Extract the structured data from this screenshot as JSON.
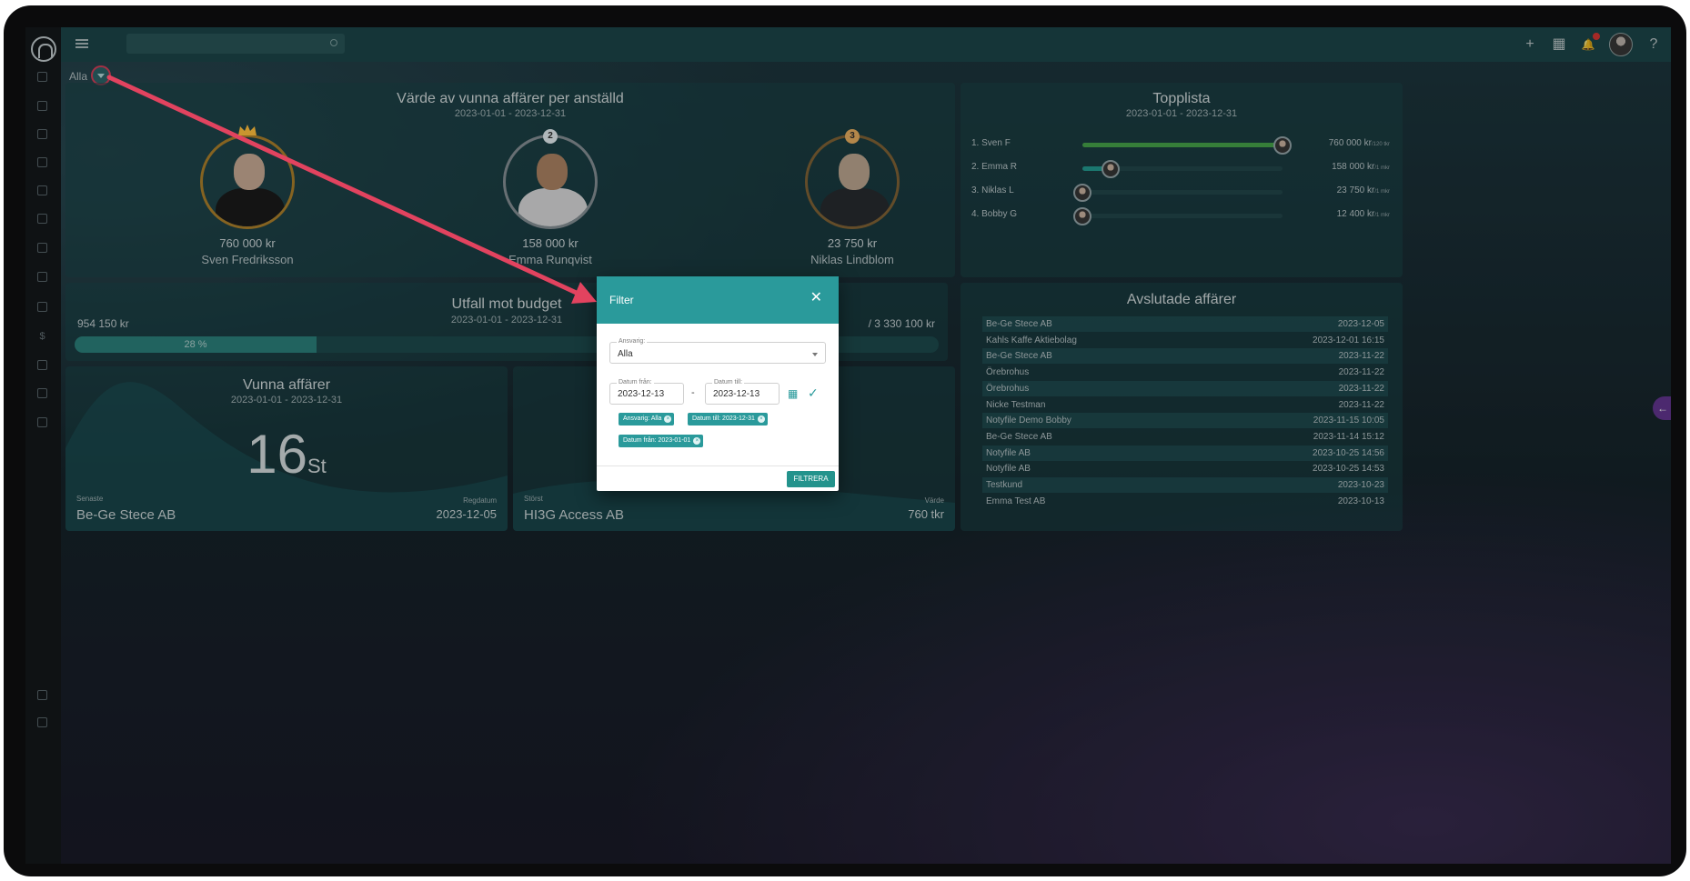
{
  "breadcrumb": "Alla",
  "winners_card": {
    "title": "Värde av vunna affärer per anställd",
    "range": "2023-01-01 - 2023-12-31",
    "podium": [
      {
        "rank": "1",
        "value": "760 000 kr",
        "name": "Sven Fredriksson"
      },
      {
        "rank": "2",
        "value": "158 000 kr",
        "name": "Emma Runqvist"
      },
      {
        "rank": "3",
        "value": "23 750 kr",
        "name": "Niklas Lindblom"
      }
    ]
  },
  "topplista": {
    "title": "Topplista",
    "range": "2023-01-01 - 2023-12-31",
    "rows": [
      {
        "name": "1. Sven F",
        "value": "760 000 kr",
        "unit": "/120 tkr",
        "fraction": 1.0
      },
      {
        "name": "2. Emma R",
        "value": "158 000 kr",
        "unit": "/1 mkr",
        "fraction": 0.14
      },
      {
        "name": "3. Niklas L",
        "value": "23 750 kr",
        "unit": "/1 mkr",
        "fraction": 0.0
      },
      {
        "name": "4. Bobby G",
        "value": "12 400 kr",
        "unit": "/1 mkr",
        "fraction": 0.0
      }
    ]
  },
  "budget": {
    "title": "Utfall mot budget",
    "range": "2023-01-01 - 2023-12-31",
    "actual": "954 150 kr",
    "target": "/ 3 330 100 kr",
    "percent_label": "28 %",
    "fraction": 0.28
  },
  "won_deals": {
    "title": "Vunna affärer",
    "range": "2023-01-01 - 2023-12-31",
    "count": "16",
    "unit": "St",
    "latest_label": "Senaste",
    "latest_value": "Be-Ge Stece AB",
    "regdate_label": "Regdatum",
    "regdate_value": "2023-12-05"
  },
  "largest_deal": {
    "largest_label": "Störst",
    "largest_value": "HI3G Access AB",
    "value_label": "Värde",
    "value_value": "760 tkr"
  },
  "closed_deals": {
    "title": "Avslutade affärer",
    "rows": [
      {
        "name": "Be-Ge Stece AB",
        "date": "2023-12-05"
      },
      {
        "name": "Kahls Kaffe Aktiebolag",
        "date": "2023-12-01 16:15"
      },
      {
        "name": "Be-Ge Stece AB",
        "date": "2023-11-22"
      },
      {
        "name": "Örebrohus",
        "date": "2023-11-22"
      },
      {
        "name": "Örebrohus",
        "date": "2023-11-22"
      },
      {
        "name": "Nicke Testman",
        "date": "2023-11-22"
      },
      {
        "name": "Notyfile Demo Bobby",
        "date": "2023-11-15 10:05"
      },
      {
        "name": "Be-Ge Stece AB",
        "date": "2023-11-14 15:12"
      },
      {
        "name": "Notyfile AB",
        "date": "2023-10-25 14:56"
      },
      {
        "name": "Notyfile AB",
        "date": "2023-10-25 14:53"
      },
      {
        "name": "Testkund",
        "date": "2023-10-23"
      },
      {
        "name": "Emma Test AB",
        "date": "2023-10-13"
      }
    ]
  },
  "filter_modal": {
    "title": "Filter",
    "close": "✕",
    "responsible_label": "Ansvarig:",
    "responsible_value": "Alla",
    "date_from_label": "Datum från:",
    "date_from_value": "2023-12-13",
    "date_to_label": "Datum till:",
    "date_to_value": "2023-12-13",
    "dash": "-",
    "chips": [
      "Ansvarig: Alla",
      "Datum till: 2023-12-31",
      "Datum från: 2023-01-01"
    ],
    "submit": "FILTRERA"
  },
  "colors": {
    "accent": "#2a9a9b",
    "annotation_arrow": "#e2435f",
    "progress_green": "#4caf50"
  },
  "icons": {
    "top_bar": [
      "plus-icon",
      "calendar-icon",
      "bell-icon",
      "help-icon"
    ]
  },
  "glyphs": {
    "plus": "+",
    "calendar": "▦",
    "bell": "🔔",
    "help": "?",
    "dollar": "$",
    "check": "✓",
    "calendar_picker": "▦",
    "chip_close": "×"
  }
}
